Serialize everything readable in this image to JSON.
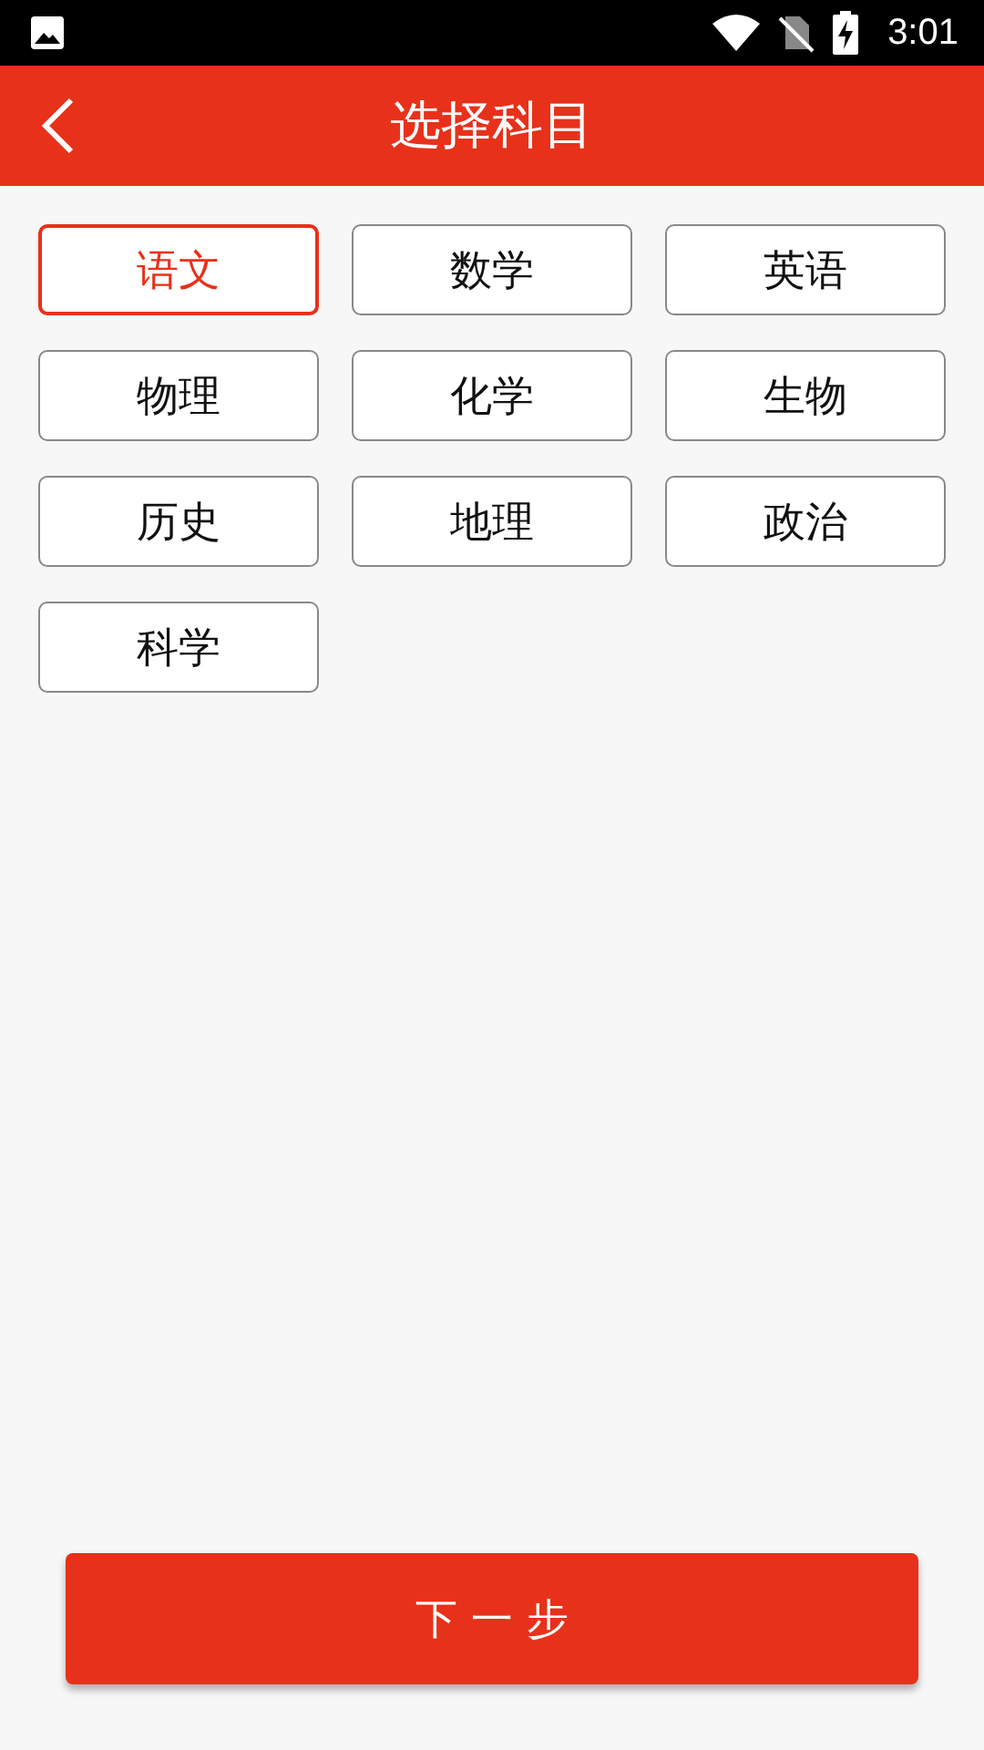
{
  "status_bar": {
    "time": "3:01"
  },
  "header": {
    "title": "选择科目"
  },
  "subjects": [
    {
      "label": "语文",
      "selected": true
    },
    {
      "label": "数学",
      "selected": false
    },
    {
      "label": "英语",
      "selected": false
    },
    {
      "label": "物理",
      "selected": false
    },
    {
      "label": "化学",
      "selected": false
    },
    {
      "label": "生物",
      "selected": false
    },
    {
      "label": "历史",
      "selected": false
    },
    {
      "label": "地理",
      "selected": false
    },
    {
      "label": "政治",
      "selected": false
    },
    {
      "label": "科学",
      "selected": false
    }
  ],
  "next_button": {
    "label": "下 一 步"
  }
}
